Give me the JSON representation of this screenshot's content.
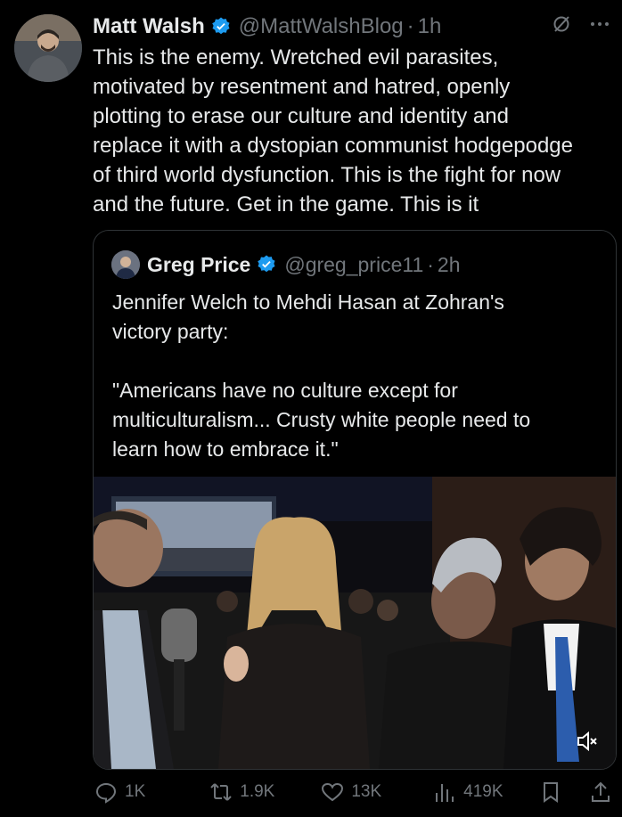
{
  "author": {
    "name": "Matt Walsh",
    "handle": "@MattWalshBlog",
    "time": "1h"
  },
  "tweet": {
    "text": "This is the enemy. Wretched evil parasites,\nmotivated by resentment and hatred, openly\nplotting to erase our culture and identity and\nreplace it with a dystopian communist hodgepodge\nof third world dysfunction. This is the fight for now\nand the future. Get in the game. This is it"
  },
  "quote": {
    "name": "Greg Price",
    "handle": "@greg_price11",
    "time": "2h",
    "text": "Jennifer Welch to Mehdi Hasan at Zohran's\nvictory party:\n\n\"Americans have no culture except for\nmulticulturalism... Crusty white people need to\nlearn how to embrace it.\""
  },
  "actions": {
    "replies": "1K",
    "reposts": "1.9K",
    "likes": "13K",
    "views": "419K"
  },
  "colors": {
    "accent": "#1d9bf0",
    "muted": "#71767b",
    "background": "#000000"
  }
}
